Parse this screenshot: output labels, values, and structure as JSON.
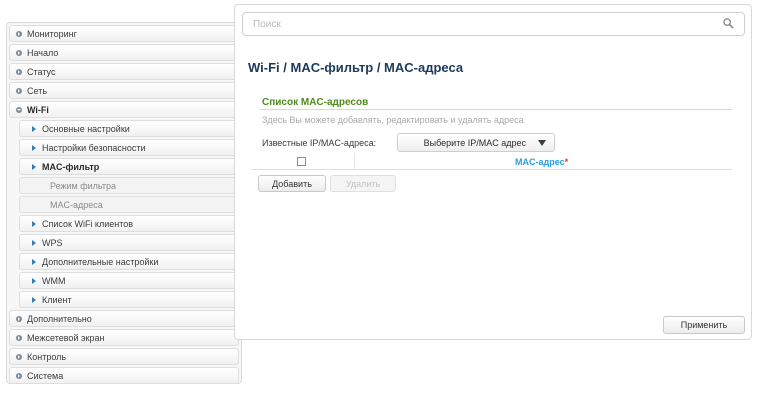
{
  "sidebar": {
    "items": [
      {
        "label": "Мониторинг"
      },
      {
        "label": "Начало"
      },
      {
        "label": "Статус"
      },
      {
        "label": "Сеть"
      },
      {
        "label": "Wi-Fi"
      },
      {
        "label": "Основные настройки"
      },
      {
        "label": "Настройки безопасности"
      },
      {
        "label": "MAC-фильтр"
      },
      {
        "label": "Режим фильтра"
      },
      {
        "label": "MAC-адреса"
      },
      {
        "label": "Список WiFi клиентов"
      },
      {
        "label": "WPS"
      },
      {
        "label": "Дополнительные настройки"
      },
      {
        "label": "WMM"
      },
      {
        "label": "Клиент"
      },
      {
        "label": "Дополнительно"
      },
      {
        "label": "Межсетевой экран"
      },
      {
        "label": "Контроль"
      },
      {
        "label": "Система"
      }
    ]
  },
  "search": {
    "placeholder": "Поиск"
  },
  "main": {
    "title": "Wi-Fi /  MAC-фильтр /  MAC-адреса",
    "section_title": "Список MAC-адресов",
    "section_desc": "Здесь Вы можете добавлять, редактировать и удалять адреса",
    "known_label": "Известные IP/MAC-адреса:",
    "select_value": "Выберите IP/MAC адрес",
    "col_mac": "MAC-адрес",
    "required_mark": "*",
    "add_label": "Добавить",
    "delete_label": "Удалить",
    "apply_label": "Применить"
  },
  "colors": {
    "title": "#1d3a5c",
    "section": "#4f8a1b",
    "column": "#2aa0da"
  }
}
